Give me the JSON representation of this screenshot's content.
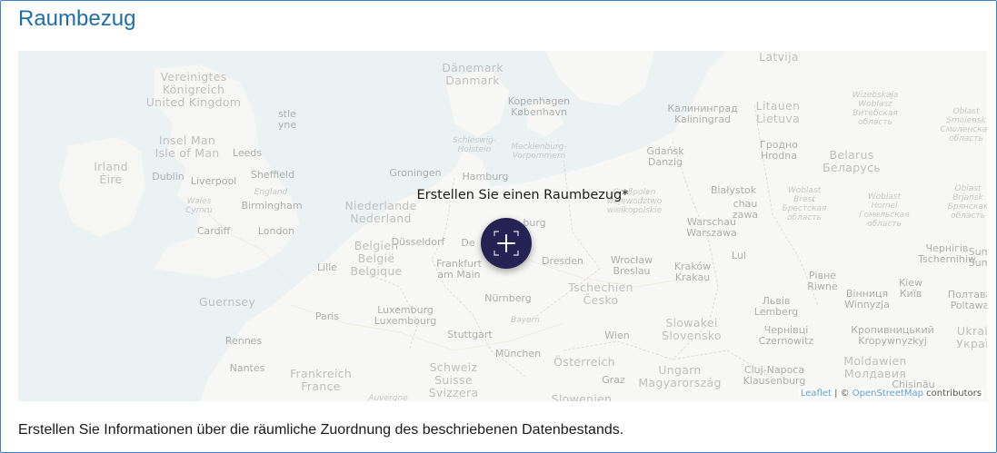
{
  "section": {
    "title": "Raumbezug",
    "description": "Erstellen Sie Informationen über die räumliche Zuordnung des beschriebenen Datenbestands."
  },
  "map": {
    "cta_label": "Erstellen Sie einen Raumbezug*",
    "add_button_icon": "add-location-icon",
    "attribution": {
      "leaflet": "Leaflet",
      "separator": " | © ",
      "osm": "OpenStreetMap",
      "suffix": " contributors"
    },
    "labels": [
      {
        "text": "Latvija",
        "kind": "country"
      },
      {
        "text": "Dänemark\nDanmark",
        "kind": "country"
      },
      {
        "text": "Vereinigtes\nKönigreich\nUnited Kingdom",
        "kind": "country"
      },
      {
        "text": "Kopenhagen\nKøbenhavn",
        "kind": "city"
      },
      {
        "text": "Калининград\nKaliningrad",
        "kind": "city"
      },
      {
        "text": "Litauen\nLietuva",
        "kind": "country"
      },
      {
        "text": "Wizebskaja\nWoblasz\nВитебская\nобласть",
        "kind": "region"
      },
      {
        "text": "Oblast\nSmolensk\nСмоленская\nобласть",
        "kind": "region"
      },
      {
        "text": "stle\nyne",
        "kind": "city"
      },
      {
        "text": "Insel Man\nIsle of Man",
        "kind": "country"
      },
      {
        "text": "Leeds",
        "kind": "city"
      },
      {
        "text": "Schleswig-\nHolstein",
        "kind": "region"
      },
      {
        "text": "Mecklenburg-\nVorpommern",
        "kind": "region"
      },
      {
        "text": "Gdańsk\nDanzig",
        "kind": "city"
      },
      {
        "text": "Гродно\nHrodna",
        "kind": "city"
      },
      {
        "text": "Belarus\nБеларусь",
        "kind": "country"
      },
      {
        "text": "Irland\nÉire",
        "kind": "country"
      },
      {
        "text": "Dublin",
        "kind": "city"
      },
      {
        "text": "Sheffield",
        "kind": "city"
      },
      {
        "text": "Liverpool",
        "kind": "city"
      },
      {
        "text": "Groningen",
        "kind": "city"
      },
      {
        "text": "Hamburg",
        "kind": "city"
      },
      {
        "text": "England",
        "kind": "region"
      },
      {
        "text": "Białystok",
        "kind": "city"
      },
      {
        "text": "Woblast\nBrest\nБрестская\nобласть",
        "kind": "region"
      },
      {
        "text": "Woblast\nHomel\nГомельская\nобласть",
        "kind": "region"
      },
      {
        "text": "Oblast\nBrjansk\nБрянская\nобласть",
        "kind": "region"
      },
      {
        "text": "Wales\nCymru",
        "kind": "region"
      },
      {
        "text": "Birmingham",
        "kind": "city"
      },
      {
        "text": "Niederlande\nNederland",
        "kind": "country"
      },
      {
        "text": "Großpolen\nwojewództwo\nwielkopolskie",
        "kind": "region"
      },
      {
        "text": "Warschau\nWarszawa",
        "kind": "city"
      },
      {
        "text": "Cardiff",
        "kind": "city"
      },
      {
        "text": "London",
        "kind": "city"
      },
      {
        "text": "Düsseldorf",
        "kind": "city"
      },
      {
        "text": "Чернігів\nTschernihiw",
        "kind": "city"
      },
      {
        "text": "Belgien\nBelgië\nBelgique",
        "kind": "country"
      },
      {
        "text": "Lille",
        "kind": "city"
      },
      {
        "text": "Frankfurt\nam Main",
        "kind": "city"
      },
      {
        "text": "Dresden",
        "kind": "city"
      },
      {
        "text": "Wrocław\nBreslau",
        "kind": "city"
      },
      {
        "text": "Kraków\nKrakau",
        "kind": "city"
      },
      {
        "text": "Lul",
        "kind": "city"
      },
      {
        "text": "Рівне\nRiwne",
        "kind": "city"
      },
      {
        "text": "Kiew\nКиїв",
        "kind": "city"
      },
      {
        "text": "Guernsey",
        "kind": "country"
      },
      {
        "text": "Tschechien\nČesko",
        "kind": "country"
      },
      {
        "text": "Вінниця\nWinnyzja",
        "kind": "city"
      },
      {
        "text": "Полтава\nPoltawa",
        "kind": "city"
      },
      {
        "text": "Paris",
        "kind": "city"
      },
      {
        "text": "Luxemburg\nLuxembourg",
        "kind": "city"
      },
      {
        "text": "Nürnberg",
        "kind": "city"
      },
      {
        "text": "Львів\nLemberg",
        "kind": "city"
      },
      {
        "text": "Bayern",
        "kind": "region"
      },
      {
        "text": "Slowakei\nSlovensko",
        "kind": "country"
      },
      {
        "text": "Чернівці\nCzernowitz",
        "kind": "city"
      },
      {
        "text": "Кропивницький\nKropywnyzkyj",
        "kind": "city"
      },
      {
        "text": "Ukrai\nУкраї",
        "kind": "country"
      },
      {
        "text": "Rennes",
        "kind": "city"
      },
      {
        "text": "Stuttgart",
        "kind": "city"
      },
      {
        "text": "Wien",
        "kind": "city"
      },
      {
        "text": "München",
        "kind": "city"
      },
      {
        "text": "Österreich",
        "kind": "country"
      },
      {
        "text": "Nantes",
        "kind": "city"
      },
      {
        "text": "Frankreich\nFrance",
        "kind": "country"
      },
      {
        "text": "Schweiz\nSuisse\nSvizzera",
        "kind": "country"
      },
      {
        "text": "Graz",
        "kind": "city"
      },
      {
        "text": "Ungarn\nMagyarország",
        "kind": "country"
      },
      {
        "text": "Cluj-Napoca\nKlausenburg",
        "kind": "city"
      },
      {
        "text": "Moldawien\nМолдавия",
        "kind": "country"
      },
      {
        "text": "Auvergne",
        "kind": "region"
      },
      {
        "text": "Slowenien",
        "kind": "country"
      },
      {
        "text": "De",
        "kind": "city"
      },
      {
        "text": "burg",
        "kind": "city"
      },
      {
        "text": "chau\nzawa",
        "kind": "city"
      },
      {
        "text": "Sum\nSum",
        "kind": "city"
      },
      {
        "text": "Chișinău",
        "kind": "city"
      }
    ]
  }
}
